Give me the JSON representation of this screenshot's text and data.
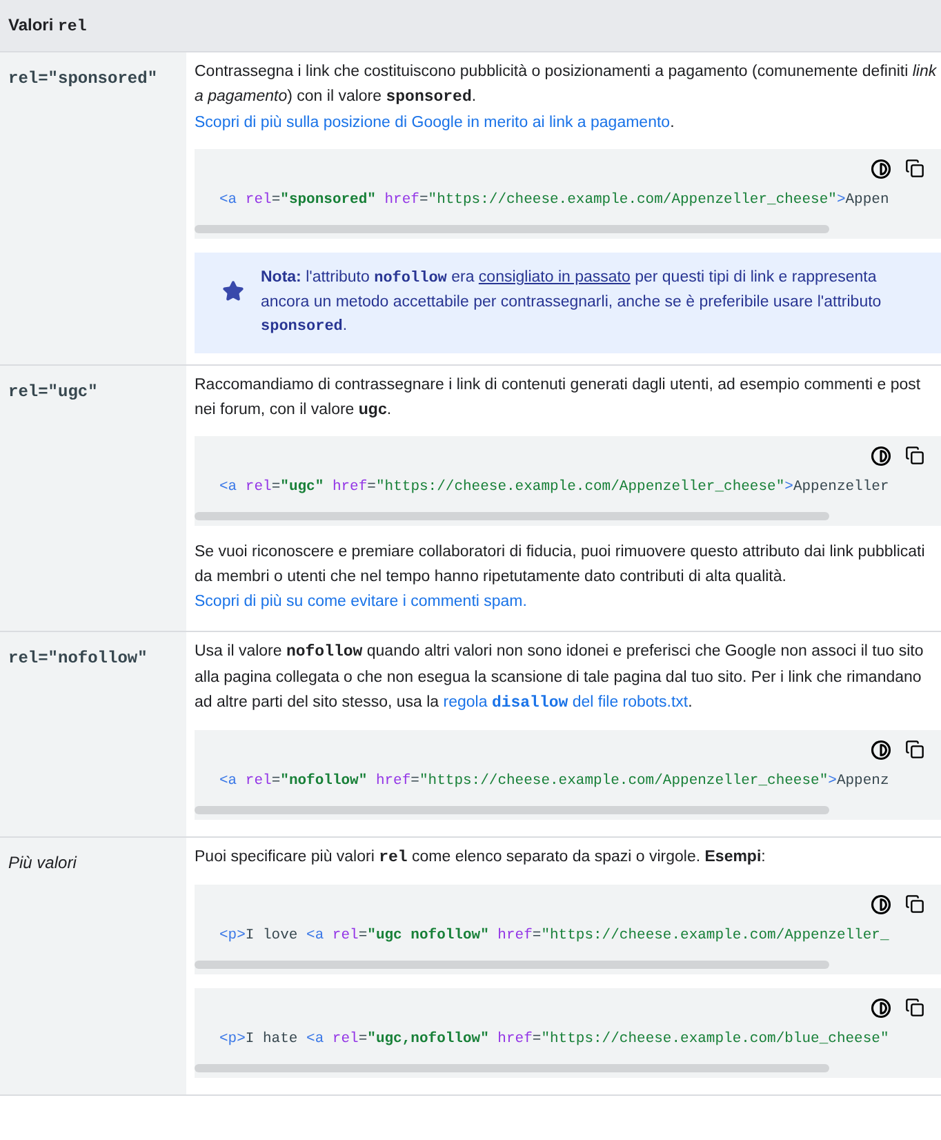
{
  "header": [
    {
      "kind": "plain",
      "text": "Valori "
    },
    {
      "kind": "code",
      "text": "rel"
    }
  ],
  "rows": [
    {
      "term": {
        "kind": "code",
        "text": "rel=\"sponsored\""
      },
      "content": [
        {
          "kind": "paragraph",
          "segments": [
            {
              "kind": "plain",
              "text": "Contrassegna i link che costituiscono pubblicità o posizionamenti a pagamento (comunemente definiti "
            },
            {
              "kind": "italic",
              "text": "link a pagamento"
            },
            {
              "kind": "plain",
              "text": ") con il valore "
            },
            {
              "kind": "code",
              "text": "sponsored"
            },
            {
              "kind": "plain",
              "text": ". "
            },
            {
              "kind": "link",
              "parts": [
                {
                  "kind": "plain",
                  "text": "Scopri di più sulla posizione di Google in merito ai link a pagamento"
                }
              ]
            },
            {
              "kind": "plain",
              "text": "."
            }
          ]
        },
        {
          "kind": "code",
          "tokens": [
            {
              "kind": "tag",
              "text": "<a"
            },
            {
              "kind": "attr",
              "text": " rel"
            },
            {
              "kind": "text",
              "text": "="
            },
            {
              "kind": "value",
              "text": "\"sponsored\""
            },
            {
              "kind": "attr",
              "text": " href"
            },
            {
              "kind": "text",
              "text": "="
            },
            {
              "kind": "string",
              "text": "\"https://cheese.example.com/Appenzeller_cheese\""
            },
            {
              "kind": "tag",
              "text": ">"
            },
            {
              "kind": "text",
              "text": "Appen"
            }
          ]
        },
        {
          "kind": "note",
          "segments": [
            {
              "kind": "bold",
              "text": "Nota:"
            },
            {
              "kind": "plain",
              "text": " l'attributo "
            },
            {
              "kind": "code",
              "text": "nofollow"
            },
            {
              "kind": "plain",
              "text": " era "
            },
            {
              "kind": "underline_link",
              "parts": [
                {
                  "kind": "plain",
                  "text": "consigliato in passato"
                }
              ]
            },
            {
              "kind": "plain",
              "text": " per questi tipi di link e rappresenta ancora un metodo accettabile per contrassegnarli, anche se è preferibile usare l'attributo "
            },
            {
              "kind": "code",
              "text": "sponsored"
            },
            {
              "kind": "plain",
              "text": "."
            }
          ]
        }
      ]
    },
    {
      "term": {
        "kind": "code",
        "text": "rel=\"ugc\""
      },
      "content": [
        {
          "kind": "paragraph",
          "segments": [
            {
              "kind": "plain",
              "text": "Raccomandiamo di contrassegnare i link di contenuti generati dagli utenti, ad esempio commenti e post nei forum, con il valore "
            },
            {
              "kind": "bold",
              "text": "ugc"
            },
            {
              "kind": "plain",
              "text": "."
            }
          ]
        },
        {
          "kind": "code",
          "tokens": [
            {
              "kind": "tag",
              "text": "<a"
            },
            {
              "kind": "attr",
              "text": " rel"
            },
            {
              "kind": "text",
              "text": "="
            },
            {
              "kind": "value",
              "text": "\"ugc\""
            },
            {
              "kind": "attr",
              "text": " href"
            },
            {
              "kind": "text",
              "text": "="
            },
            {
              "kind": "string",
              "text": "\"https://cheese.example.com/Appenzeller_cheese\""
            },
            {
              "kind": "tag",
              "text": ">"
            },
            {
              "kind": "text",
              "text": "Appenzeller"
            }
          ]
        },
        {
          "kind": "paragraph",
          "segments": [
            {
              "kind": "plain",
              "text": "Se vuoi riconoscere e premiare collaboratori di fiducia, puoi rimuovere questo attributo dai link pubblicati da membri o utenti che nel tempo hanno ripetutamente dato contributi di alta qualità. "
            },
            {
              "kind": "link",
              "parts": [
                {
                  "kind": "plain",
                  "text": "Scopri di più su come evitare i commenti spam."
                }
              ]
            }
          ]
        }
      ]
    },
    {
      "term": {
        "kind": "code",
        "text": "rel=\"nofollow\""
      },
      "content": [
        {
          "kind": "paragraph",
          "segments": [
            {
              "kind": "plain",
              "text": "Usa il valore "
            },
            {
              "kind": "code",
              "text": "nofollow"
            },
            {
              "kind": "plain",
              "text": " quando altri valori non sono idonei e preferisci che Google non associ il tuo sito alla pagina collegata o che non esegua la scansione di tale pagina dal tuo sito. Per i link che rimandano ad altre parti del sito stesso, usa la "
            },
            {
              "kind": "link",
              "parts": [
                {
                  "kind": "plain",
                  "text": "regola "
                },
                {
                  "kind": "code",
                  "text": "disallow"
                },
                {
                  "kind": "plain",
                  "text": " del file robots.txt"
                }
              ]
            },
            {
              "kind": "plain",
              "text": "."
            }
          ]
        },
        {
          "kind": "code",
          "tokens": [
            {
              "kind": "tag",
              "text": "<a"
            },
            {
              "kind": "attr",
              "text": " rel"
            },
            {
              "kind": "text",
              "text": "="
            },
            {
              "kind": "value",
              "text": "\"nofollow\""
            },
            {
              "kind": "attr",
              "text": " href"
            },
            {
              "kind": "text",
              "text": "="
            },
            {
              "kind": "string",
              "text": "\"https://cheese.example.com/Appenzeller_cheese\""
            },
            {
              "kind": "tag",
              "text": ">"
            },
            {
              "kind": "text",
              "text": "Appenz"
            }
          ]
        }
      ]
    },
    {
      "term": {
        "kind": "italic",
        "text": "Più valori"
      },
      "content": [
        {
          "kind": "paragraph",
          "segments": [
            {
              "kind": "plain",
              "text": "Puoi specificare più valori "
            },
            {
              "kind": "code",
              "text": "rel"
            },
            {
              "kind": "plain",
              "text": " come elenco separato da spazi o virgole. "
            },
            {
              "kind": "bold",
              "text": "Esempi"
            },
            {
              "kind": "plain",
              "text": ":"
            }
          ]
        },
        {
          "kind": "code",
          "tokens": [
            {
              "kind": "tag",
              "text": "<p>"
            },
            {
              "kind": "text",
              "text": "I love "
            },
            {
              "kind": "tag",
              "text": "<a"
            },
            {
              "kind": "attr",
              "text": " rel"
            },
            {
              "kind": "text",
              "text": "="
            },
            {
              "kind": "value",
              "text": "\"ugc nofollow\""
            },
            {
              "kind": "attr",
              "text": " href"
            },
            {
              "kind": "text",
              "text": "="
            },
            {
              "kind": "string",
              "text": "\"https://cheese.example.com/Appenzeller_"
            }
          ]
        },
        {
          "kind": "code",
          "tokens": [
            {
              "kind": "tag",
              "text": "<p>"
            },
            {
              "kind": "text",
              "text": "I hate "
            },
            {
              "kind": "tag",
              "text": "<a"
            },
            {
              "kind": "attr",
              "text": " rel"
            },
            {
              "kind": "text",
              "text": "="
            },
            {
              "kind": "value",
              "text": "\"ugc,nofollow\""
            },
            {
              "kind": "attr",
              "text": " href"
            },
            {
              "kind": "text",
              "text": "="
            },
            {
              "kind": "string",
              "text": "\"https://cheese.example.com/blue_cheese\""
            }
          ]
        }
      ]
    }
  ]
}
